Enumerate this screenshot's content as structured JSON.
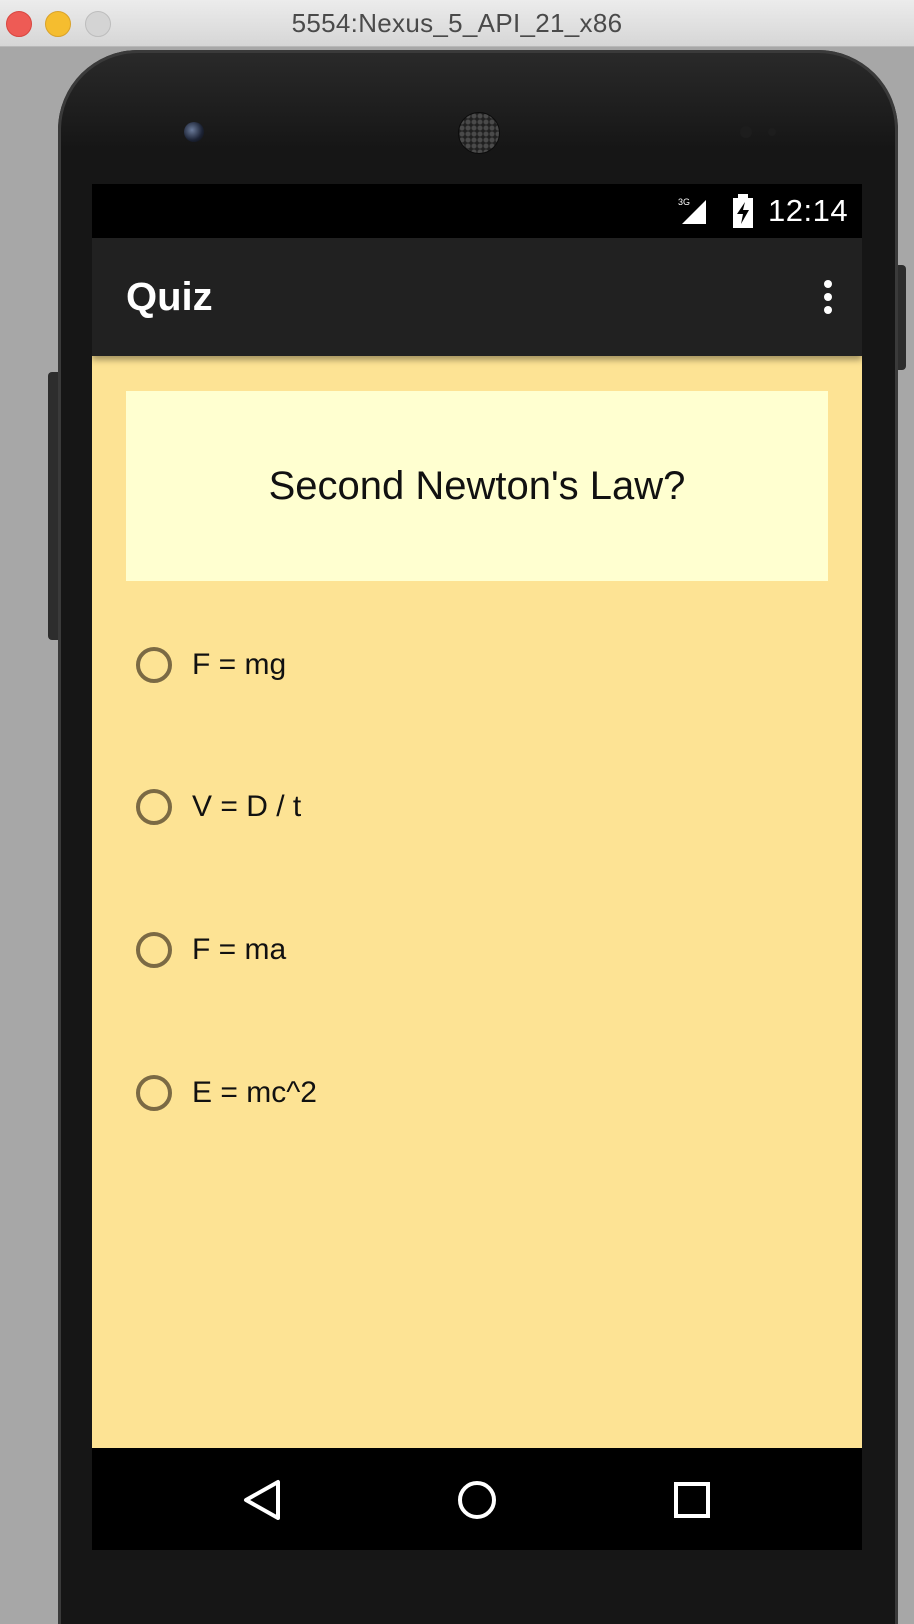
{
  "window": {
    "title": "5554:Nexus_5_API_21_x86"
  },
  "status_bar": {
    "network": "3G",
    "time": "12:14"
  },
  "app_bar": {
    "title": "Quiz",
    "overflow_icon": "more-vert-icon"
  },
  "question": {
    "text": "Second Newton's Law?"
  },
  "options": [
    {
      "label": "F = mg",
      "selected": false
    },
    {
      "label": "V = D / t",
      "selected": false
    },
    {
      "label": "F = ma",
      "selected": false
    },
    {
      "label": "E = mc^2",
      "selected": false
    }
  ],
  "nav_bar": {
    "back_icon": "back-triangle-icon",
    "home_icon": "home-circle-icon",
    "recents_icon": "recents-square-icon"
  },
  "colors": {
    "screen_background": "#fde394",
    "question_background": "#ffffd0",
    "app_bar": "#212121",
    "radio_ring": "#7b6a44"
  }
}
